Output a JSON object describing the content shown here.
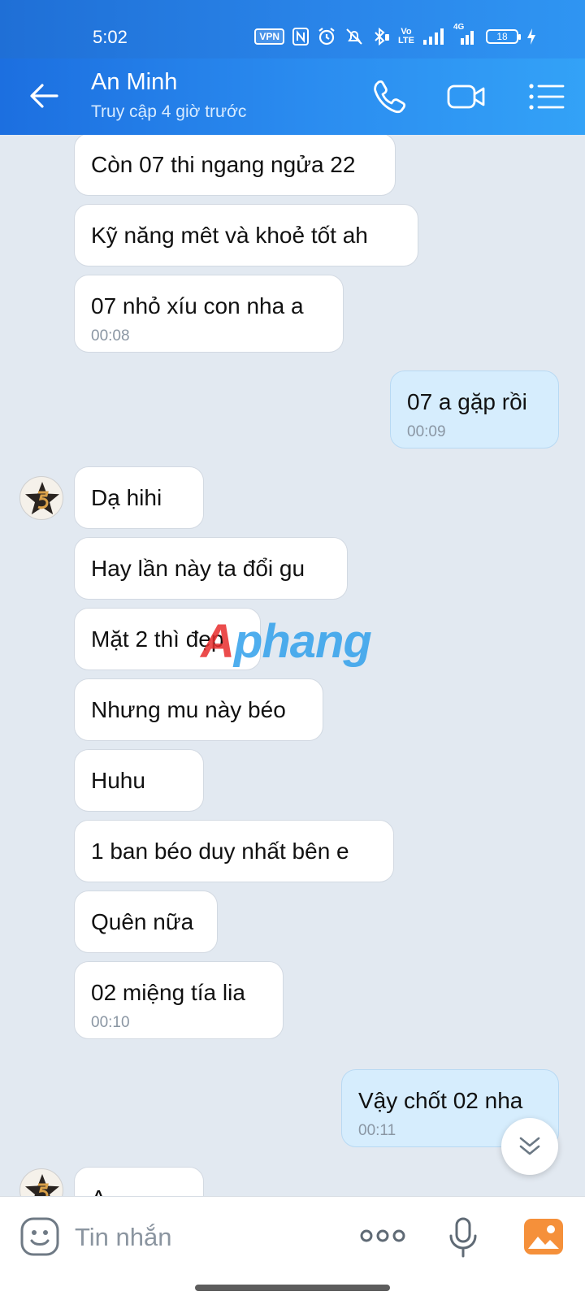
{
  "status_bar": {
    "time": "5:02",
    "vpn": "VPN",
    "network": "4G",
    "battery": "18",
    "icons": [
      "vpn-icon",
      "nfc-icon",
      "alarm-icon",
      "mute-icon",
      "bluetooth-icon",
      "volte-icon",
      "signal-icon",
      "4g-signal-icon",
      "battery-icon",
      "charging-icon"
    ]
  },
  "header": {
    "contact_name": "An Minh",
    "last_seen": "Truy cập 4 giờ trước",
    "accent_color": "#2b8df0"
  },
  "messages": [
    {
      "direction": "in",
      "text": "Còn 07 thi ngang ngửa 22",
      "time": ""
    },
    {
      "direction": "in",
      "text": "Kỹ năng mêt và khoẻ tốt ah",
      "time": ""
    },
    {
      "direction": "in",
      "text": "07 nhỏ xíu con nha a",
      "time": "00:08"
    },
    {
      "direction": "out",
      "text": "07 a gặp rồi",
      "time": "00:09"
    },
    {
      "direction": "in",
      "text": "Dạ hihi",
      "time": ""
    },
    {
      "direction": "in",
      "text": "Hay lần này ta đổi gu",
      "time": ""
    },
    {
      "direction": "in",
      "text": "Mặt 2 thì đẹp",
      "time": ""
    },
    {
      "direction": "in",
      "text": "Nhưng mu này béo",
      "time": ""
    },
    {
      "direction": "in",
      "text": "Huhu",
      "time": ""
    },
    {
      "direction": "in",
      "text": "1 ban béo duy nhất bên e",
      "time": ""
    },
    {
      "direction": "in",
      "text": "Quên nữa",
      "time": ""
    },
    {
      "direction": "in",
      "text": "02 miệng tía lia",
      "time": "00:10"
    },
    {
      "direction": "out",
      "text": "Vậy chốt 02 nha",
      "time": "00:11"
    },
    {
      "direction": "in",
      "text": "A",
      "time": ""
    }
  ],
  "watermark": {
    "part1": "A",
    "part2": "phang"
  },
  "input": {
    "placeholder": "Tin nhắn"
  }
}
